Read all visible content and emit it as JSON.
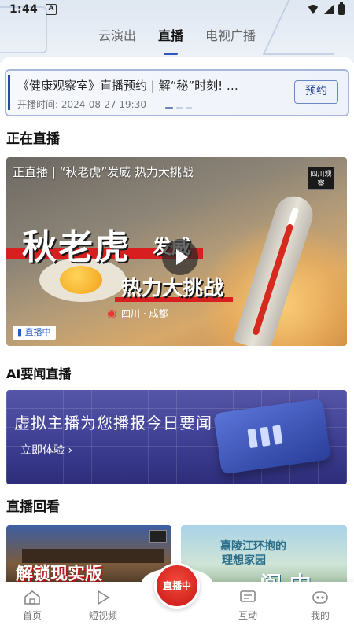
{
  "status_bar": {
    "time": "1:44",
    "notification_label": "A"
  },
  "top_tabs": [
    {
      "label": "云演出",
      "active": false
    },
    {
      "label": "直播",
      "active": true
    },
    {
      "label": "电视广播",
      "active": false
    }
  ],
  "booking": {
    "title": "《健康观察室》直播预约 | 解“秘”时刻! …",
    "time": "开播时间: 2024-08-27 19:30",
    "button": "预约"
  },
  "live_now": {
    "section_title": "正在直播",
    "card_title": "正直播 | “秋老虎”发威 热力大挑战",
    "channel_logo": "四川观察",
    "headline_main": "秋老虎",
    "headline_suffix": "发威",
    "headline_sub": "热力大挑战",
    "location": "四川 · 成都",
    "badge": "直播中"
  },
  "ai_news": {
    "section_title": "AI要闻直播",
    "headline": "虚拟主播为您播报今日要闻",
    "cta": "立即体验 ›"
  },
  "replay": {
    "section_title": "直播回看",
    "items": [
      {
        "text": "解锁现实版"
      },
      {
        "text_line1": "嘉陵江环抱的",
        "text_line2": "理想家园",
        "text_line3": "阆 中"
      }
    ]
  },
  "bottom_nav": {
    "items": [
      {
        "label": "首页",
        "icon": "home-icon"
      },
      {
        "label": "短视频",
        "icon": "play-icon"
      },
      {
        "label": "直播中",
        "icon": "live-icon"
      },
      {
        "label": "互动",
        "icon": "chat-icon"
      },
      {
        "label": "我的",
        "icon": "profile-icon"
      }
    ]
  },
  "colors": {
    "accent": "#3355bb",
    "live_red": "#d81e1e",
    "ai_card": "#3e3f93"
  }
}
